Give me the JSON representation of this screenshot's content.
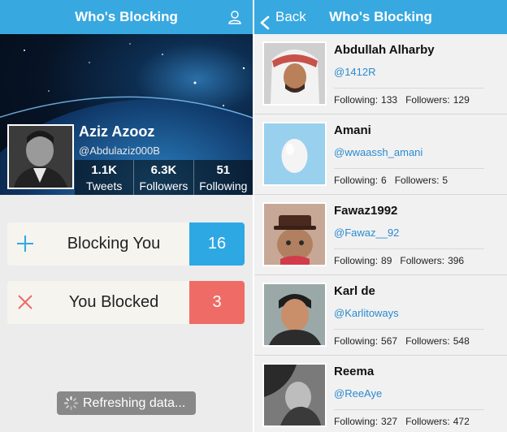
{
  "left": {
    "title": "Who's Blocking",
    "profile": {
      "name": "Aziz Azooz",
      "handle": "@Abdulaziz000B",
      "stats": [
        {
          "value": "1.1K",
          "label": "Tweets"
        },
        {
          "value": "6.3K",
          "label": "Followers"
        },
        {
          "value": "51",
          "label": "Following"
        }
      ]
    },
    "blocking_you": {
      "label": "Blocking You",
      "count": "16",
      "color": "#2ea8e3"
    },
    "you_blocked": {
      "label": "You Blocked",
      "count": "3",
      "color": "#ef6b66"
    },
    "toast": "Refreshing data..."
  },
  "right": {
    "back_label": "Back",
    "title": "Who's Blocking",
    "items": [
      {
        "name": "Abdullah Alharby",
        "handle": "@1412R",
        "following_label": "Following:",
        "following": "133",
        "followers_label": "Followers:",
        "followers": "129"
      },
      {
        "name": "Amani",
        "handle": "@wwaassh_amani",
        "following_label": "Following:",
        "following": "6",
        "followers_label": "Followers:",
        "followers": "5"
      },
      {
        "name": "Fawaz1992",
        "handle": "@Fawaz__92",
        "following_label": "Following:",
        "following": "89",
        "followers_label": "Followers:",
        "followers": "396"
      },
      {
        "name": "Karl de",
        "handle": "@Karlitoways",
        "following_label": "Following:",
        "following": "567",
        "followers_label": "Followers:",
        "followers": "548"
      },
      {
        "name": "Reema",
        "handle": "@ReeAye",
        "following_label": "Following:",
        "following": "327",
        "followers_label": "Followers:",
        "followers": "472"
      }
    ]
  },
  "colors": {
    "nav": "#38a8e0",
    "link": "#2a8ad0"
  },
  "icons": [
    "user-icon",
    "plus-icon",
    "close-icon",
    "spinner-icon",
    "chevron-left-icon"
  ]
}
